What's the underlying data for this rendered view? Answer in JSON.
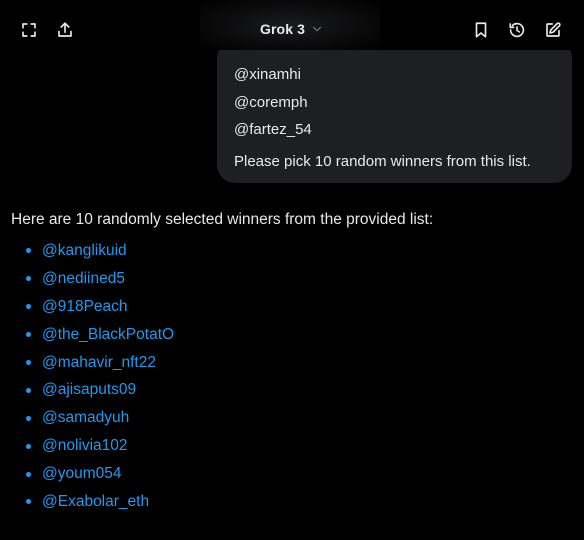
{
  "header": {
    "model_name": "Grok 3",
    "icons": [
      "expand-icon",
      "share-icon",
      "bookmark-icon",
      "history-icon",
      "new-chat-icon"
    ]
  },
  "user_message": {
    "handles": [
      "@xinamhi",
      "@coremph",
      "@fartez_54"
    ],
    "request": "Please pick 10 random winners from this list."
  },
  "response": {
    "intro": "Here are 10 randomly selected winners from the provided list:",
    "winners": [
      "@kanglikuid",
      "@nediined5",
      "@918Peach",
      "@the_BlackPotatO",
      "@mahavir_nft22",
      "@ajisaputs09",
      "@samadyuh",
      "@nolivia102",
      "@youm054",
      "@Exabolar_eth"
    ]
  },
  "colors": {
    "background": "#000000",
    "bubble": "#1d1f23",
    "text": "#e7e9ea",
    "link": "#1d9bf0"
  }
}
